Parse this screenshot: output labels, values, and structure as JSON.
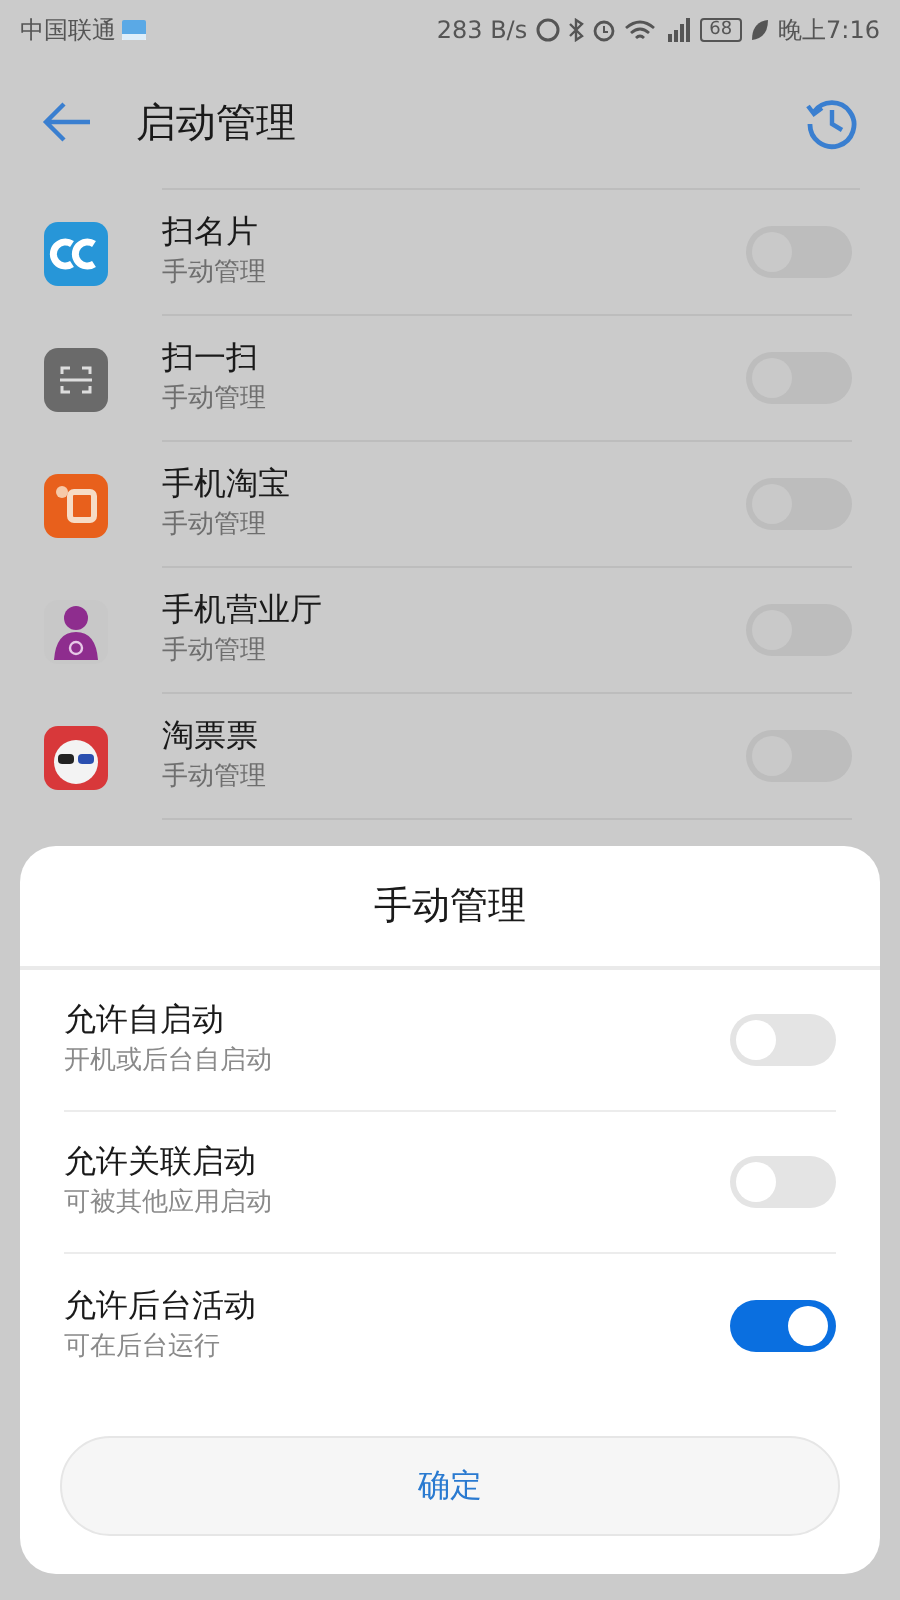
{
  "status_bar": {
    "carrier": "中国联通",
    "speed": "283 B/s",
    "battery": "68",
    "time": "晚上7:16"
  },
  "app_bar": {
    "title": "启动管理"
  },
  "apps": [
    {
      "name": "扫名片",
      "subtitle": "手动管理",
      "on": false
    },
    {
      "name": "扫一扫",
      "subtitle": "手动管理",
      "on": false
    },
    {
      "name": "手机淘宝",
      "subtitle": "手动管理",
      "on": false
    },
    {
      "name": "手机营业厅",
      "subtitle": "手动管理",
      "on": false
    },
    {
      "name": "淘票票",
      "subtitle": "手动管理",
      "on": false
    }
  ],
  "dialog": {
    "title": "手动管理",
    "options": [
      {
        "label": "允许自启动",
        "description": "开机或后台自启动",
        "on": false
      },
      {
        "label": "允许关联启动",
        "description": "可被其他应用启动",
        "on": false
      },
      {
        "label": "允许后台活动",
        "description": "可在后台运行",
        "on": true
      }
    ],
    "button": "确定"
  }
}
